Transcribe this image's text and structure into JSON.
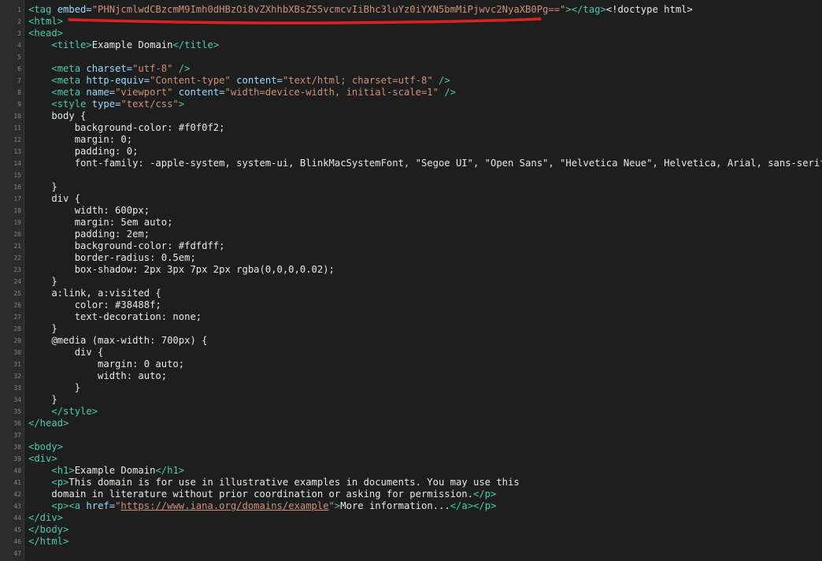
{
  "lines": [
    {
      "n": "1",
      "segs": [
        {
          "t": "<tag ",
          "c": "tag"
        },
        {
          "t": "embed=",
          "c": "attr"
        },
        {
          "t": "\"PHNjcmlwdCBzcmM9Imh0dHBzOi8vZXhhbXBsZS5vcmcvIiBhc3luYz0iYXN5bmMiPjwvc2NyaXB0Pg==\"",
          "c": "str"
        },
        {
          "t": "></tag>",
          "c": "tag"
        },
        {
          "t": "<!doctype html>",
          "c": "txt"
        }
      ]
    },
    {
      "n": "2",
      "segs": [
        {
          "t": "<html>",
          "c": "tag"
        }
      ]
    },
    {
      "n": "3",
      "segs": [
        {
          "t": "<head>",
          "c": "tag"
        }
      ]
    },
    {
      "n": "4",
      "segs": [
        {
          "t": "    ",
          "c": "txt"
        },
        {
          "t": "<title>",
          "c": "tag"
        },
        {
          "t": "Example Domain",
          "c": "txt"
        },
        {
          "t": "</title>",
          "c": "tag"
        }
      ]
    },
    {
      "n": "5",
      "segs": []
    },
    {
      "n": "6",
      "segs": [
        {
          "t": "    ",
          "c": "txt"
        },
        {
          "t": "<meta ",
          "c": "tag"
        },
        {
          "t": "charset=",
          "c": "attr"
        },
        {
          "t": "\"utf-8\"",
          "c": "str"
        },
        {
          "t": " />",
          "c": "tag"
        }
      ]
    },
    {
      "n": "7",
      "segs": [
        {
          "t": "    ",
          "c": "txt"
        },
        {
          "t": "<meta ",
          "c": "tag"
        },
        {
          "t": "http-equiv=",
          "c": "attr"
        },
        {
          "t": "\"Content-type\"",
          "c": "str"
        },
        {
          "t": " content=",
          "c": "attr"
        },
        {
          "t": "\"text/html; charset=utf-8\"",
          "c": "str"
        },
        {
          "t": " />",
          "c": "tag"
        }
      ]
    },
    {
      "n": "8",
      "segs": [
        {
          "t": "    ",
          "c": "txt"
        },
        {
          "t": "<meta ",
          "c": "tag"
        },
        {
          "t": "name=",
          "c": "attr"
        },
        {
          "t": "\"viewport\"",
          "c": "str"
        },
        {
          "t": " content=",
          "c": "attr"
        },
        {
          "t": "\"width=device-width, initial-scale=1\"",
          "c": "str"
        },
        {
          "t": " />",
          "c": "tag"
        }
      ]
    },
    {
      "n": "9",
      "segs": [
        {
          "t": "    ",
          "c": "txt"
        },
        {
          "t": "<style ",
          "c": "tag"
        },
        {
          "t": "type=",
          "c": "attr"
        },
        {
          "t": "\"text/css\"",
          "c": "str"
        },
        {
          "t": ">",
          "c": "tag"
        }
      ]
    },
    {
      "n": "10",
      "segs": [
        {
          "t": "    body {",
          "c": "txt"
        }
      ]
    },
    {
      "n": "11",
      "segs": [
        {
          "t": "        background-color: #f0f0f2;",
          "c": "txt"
        }
      ]
    },
    {
      "n": "12",
      "segs": [
        {
          "t": "        margin: 0;",
          "c": "txt"
        }
      ]
    },
    {
      "n": "13",
      "segs": [
        {
          "t": "        padding: 0;",
          "c": "txt"
        }
      ]
    },
    {
      "n": "14",
      "segs": [
        {
          "t": "        font-family: -apple-system, system-ui, BlinkMacSystemFont, \"Segoe UI\", \"Open Sans\", \"Helvetica Neue\", Helvetica, Arial, sans-serif;",
          "c": "txt"
        }
      ]
    },
    {
      "n": "15",
      "segs": []
    },
    {
      "n": "16",
      "segs": [
        {
          "t": "    }",
          "c": "txt"
        }
      ]
    },
    {
      "n": "17",
      "segs": [
        {
          "t": "    div {",
          "c": "txt"
        }
      ]
    },
    {
      "n": "18",
      "segs": [
        {
          "t": "        width: 600px;",
          "c": "txt"
        }
      ]
    },
    {
      "n": "19",
      "segs": [
        {
          "t": "        margin: 5em auto;",
          "c": "txt"
        }
      ]
    },
    {
      "n": "20",
      "segs": [
        {
          "t": "        padding: 2em;",
          "c": "txt"
        }
      ]
    },
    {
      "n": "21",
      "segs": [
        {
          "t": "        background-color: #fdfdff;",
          "c": "txt"
        }
      ]
    },
    {
      "n": "22",
      "segs": [
        {
          "t": "        border-radius: 0.5em;",
          "c": "txt"
        }
      ]
    },
    {
      "n": "23",
      "segs": [
        {
          "t": "        box-shadow: 2px 3px 7px 2px rgba(0,0,0,0.02);",
          "c": "txt"
        }
      ]
    },
    {
      "n": "24",
      "segs": [
        {
          "t": "    }",
          "c": "txt"
        }
      ]
    },
    {
      "n": "25",
      "segs": [
        {
          "t": "    a:link, a:visited {",
          "c": "txt"
        }
      ]
    },
    {
      "n": "26",
      "segs": [
        {
          "t": "        color: #38488f;",
          "c": "txt"
        }
      ]
    },
    {
      "n": "27",
      "segs": [
        {
          "t": "        text-decoration: none;",
          "c": "txt"
        }
      ]
    },
    {
      "n": "28",
      "segs": [
        {
          "t": "    }",
          "c": "txt"
        }
      ]
    },
    {
      "n": "29",
      "segs": [
        {
          "t": "    @media (max-width: 700px) {",
          "c": "txt"
        }
      ]
    },
    {
      "n": "30",
      "segs": [
        {
          "t": "        div {",
          "c": "txt"
        }
      ]
    },
    {
      "n": "31",
      "segs": [
        {
          "t": "            margin: 0 auto;",
          "c": "txt"
        }
      ]
    },
    {
      "n": "32",
      "segs": [
        {
          "t": "            width: auto;",
          "c": "txt"
        }
      ]
    },
    {
      "n": "33",
      "segs": [
        {
          "t": "        }",
          "c": "txt"
        }
      ]
    },
    {
      "n": "34",
      "segs": [
        {
          "t": "    }",
          "c": "txt"
        }
      ]
    },
    {
      "n": "35",
      "segs": [
        {
          "t": "    ",
          "c": "txt"
        },
        {
          "t": "</style>",
          "c": "tag"
        }
      ]
    },
    {
      "n": "36",
      "segs": [
        {
          "t": "</head>",
          "c": "tag"
        }
      ]
    },
    {
      "n": "37",
      "segs": []
    },
    {
      "n": "38",
      "segs": [
        {
          "t": "<body>",
          "c": "tag"
        }
      ]
    },
    {
      "n": "39",
      "segs": [
        {
          "t": "<div>",
          "c": "tag"
        }
      ]
    },
    {
      "n": "40",
      "segs": [
        {
          "t": "    ",
          "c": "txt"
        },
        {
          "t": "<h1>",
          "c": "tag"
        },
        {
          "t": "Example Domain",
          "c": "txt"
        },
        {
          "t": "</h1>",
          "c": "tag"
        }
      ]
    },
    {
      "n": "41",
      "segs": [
        {
          "t": "    ",
          "c": "txt"
        },
        {
          "t": "<p>",
          "c": "tag"
        },
        {
          "t": "This domain is for use in illustrative examples in documents. You may use this",
          "c": "txt"
        }
      ]
    },
    {
      "n": "42",
      "segs": [
        {
          "t": "    domain in literature without prior coordination or asking for permission.",
          "c": "txt"
        },
        {
          "t": "</p>",
          "c": "tag"
        }
      ]
    },
    {
      "n": "43",
      "segs": [
        {
          "t": "    ",
          "c": "txt"
        },
        {
          "t": "<p>",
          "c": "tag"
        },
        {
          "t": "<a ",
          "c": "tag"
        },
        {
          "t": "href=",
          "c": "attr"
        },
        {
          "t": "\"",
          "c": "str"
        },
        {
          "t": "https://www.iana.org/domains/example",
          "c": "link"
        },
        {
          "t": "\"",
          "c": "str"
        },
        {
          "t": ">",
          "c": "tag"
        },
        {
          "t": "More information...",
          "c": "txt"
        },
        {
          "t": "</a></p>",
          "c": "tag"
        }
      ]
    },
    {
      "n": "44",
      "segs": [
        {
          "t": "</div>",
          "c": "tag"
        }
      ]
    },
    {
      "n": "45",
      "segs": [
        {
          "t": "</body>",
          "c": "tag"
        }
      ]
    },
    {
      "n": "46",
      "segs": [
        {
          "t": "</html>",
          "c": "tag"
        }
      ]
    },
    {
      "n": "47",
      "segs": []
    }
  ],
  "annotation": {
    "color": "#e02020"
  }
}
